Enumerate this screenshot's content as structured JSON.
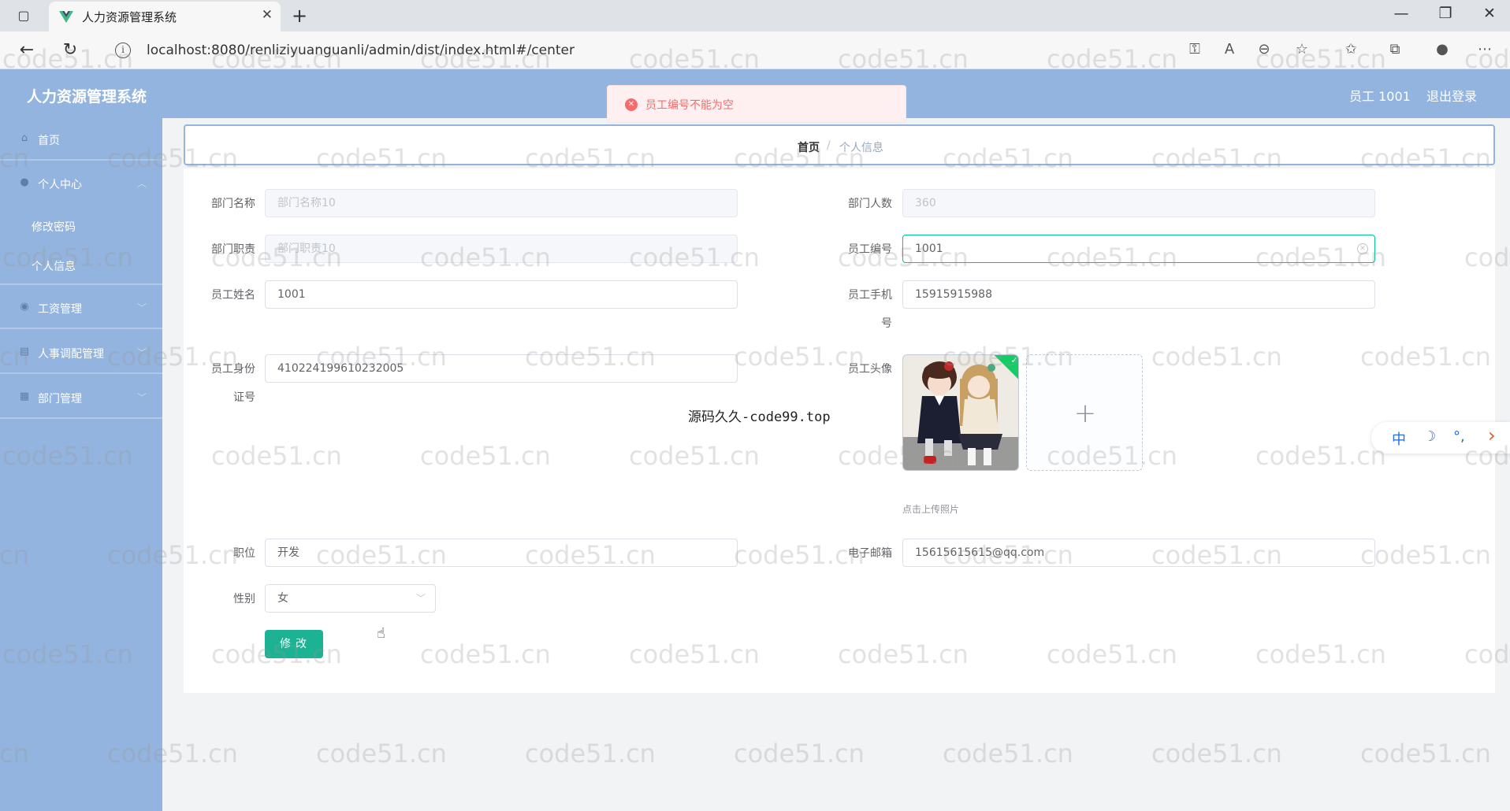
{
  "browser": {
    "tab_title": "人力资源管理系统",
    "url": "localhost:8080/renliziyuanguanli/admin/dist/index.html#/center"
  },
  "header": {
    "title": "人力资源管理系统",
    "user": "员工 1001",
    "logout": "退出登录"
  },
  "sidebar": {
    "items": [
      {
        "label": "首页",
        "icon": "home-icon"
      },
      {
        "label": "个人中心",
        "icon": "user-icon"
      },
      {
        "label": "工资管理",
        "icon": "location-icon"
      },
      {
        "label": "人事调配管理",
        "icon": "document-icon"
      },
      {
        "label": "部门管理",
        "icon": "building-icon"
      }
    ],
    "subitems": [
      "修改密码",
      "个人信息"
    ]
  },
  "breadcrumb": {
    "home": "首页",
    "separator": "/",
    "current": "个人信息"
  },
  "form": {
    "dept_name_label": "部门名称",
    "dept_name_placeholder": "部门名称10",
    "dept_count_label": "部门人数",
    "dept_count_value": "360",
    "dept_duty_label": "部门职责",
    "dept_duty_placeholder": "部门职责10",
    "emp_no_label": "员工编号",
    "emp_no_value": "1001",
    "emp_name_label": "员工姓名",
    "emp_name_value": "1001",
    "emp_phone_label_1": "员工手机",
    "emp_phone_label_2": "号",
    "emp_phone_value": "15915915988",
    "emp_id_label_1": "员工身份",
    "emp_id_label_2": "证号",
    "emp_id_value": "410224199610232005",
    "avatar_label": "员工头像",
    "upload_tip": "点击上传照片",
    "position_label": "职位",
    "position_value": "开发",
    "email_label": "电子邮箱",
    "email_value": "15615615615@qq.com",
    "gender_label": "性别",
    "gender_value": "女",
    "submit_label": "修改"
  },
  "toast": {
    "message": "员工编号不能为空"
  },
  "overlay_text": "源码久久-code99.top",
  "watermark": "code51.cn",
  "ime": [
    "中",
    "☽",
    "°,",
    "›"
  ],
  "colors": {
    "header_bg": "#93b4de",
    "accent": "#1bb394",
    "error": "#f56c6c"
  }
}
